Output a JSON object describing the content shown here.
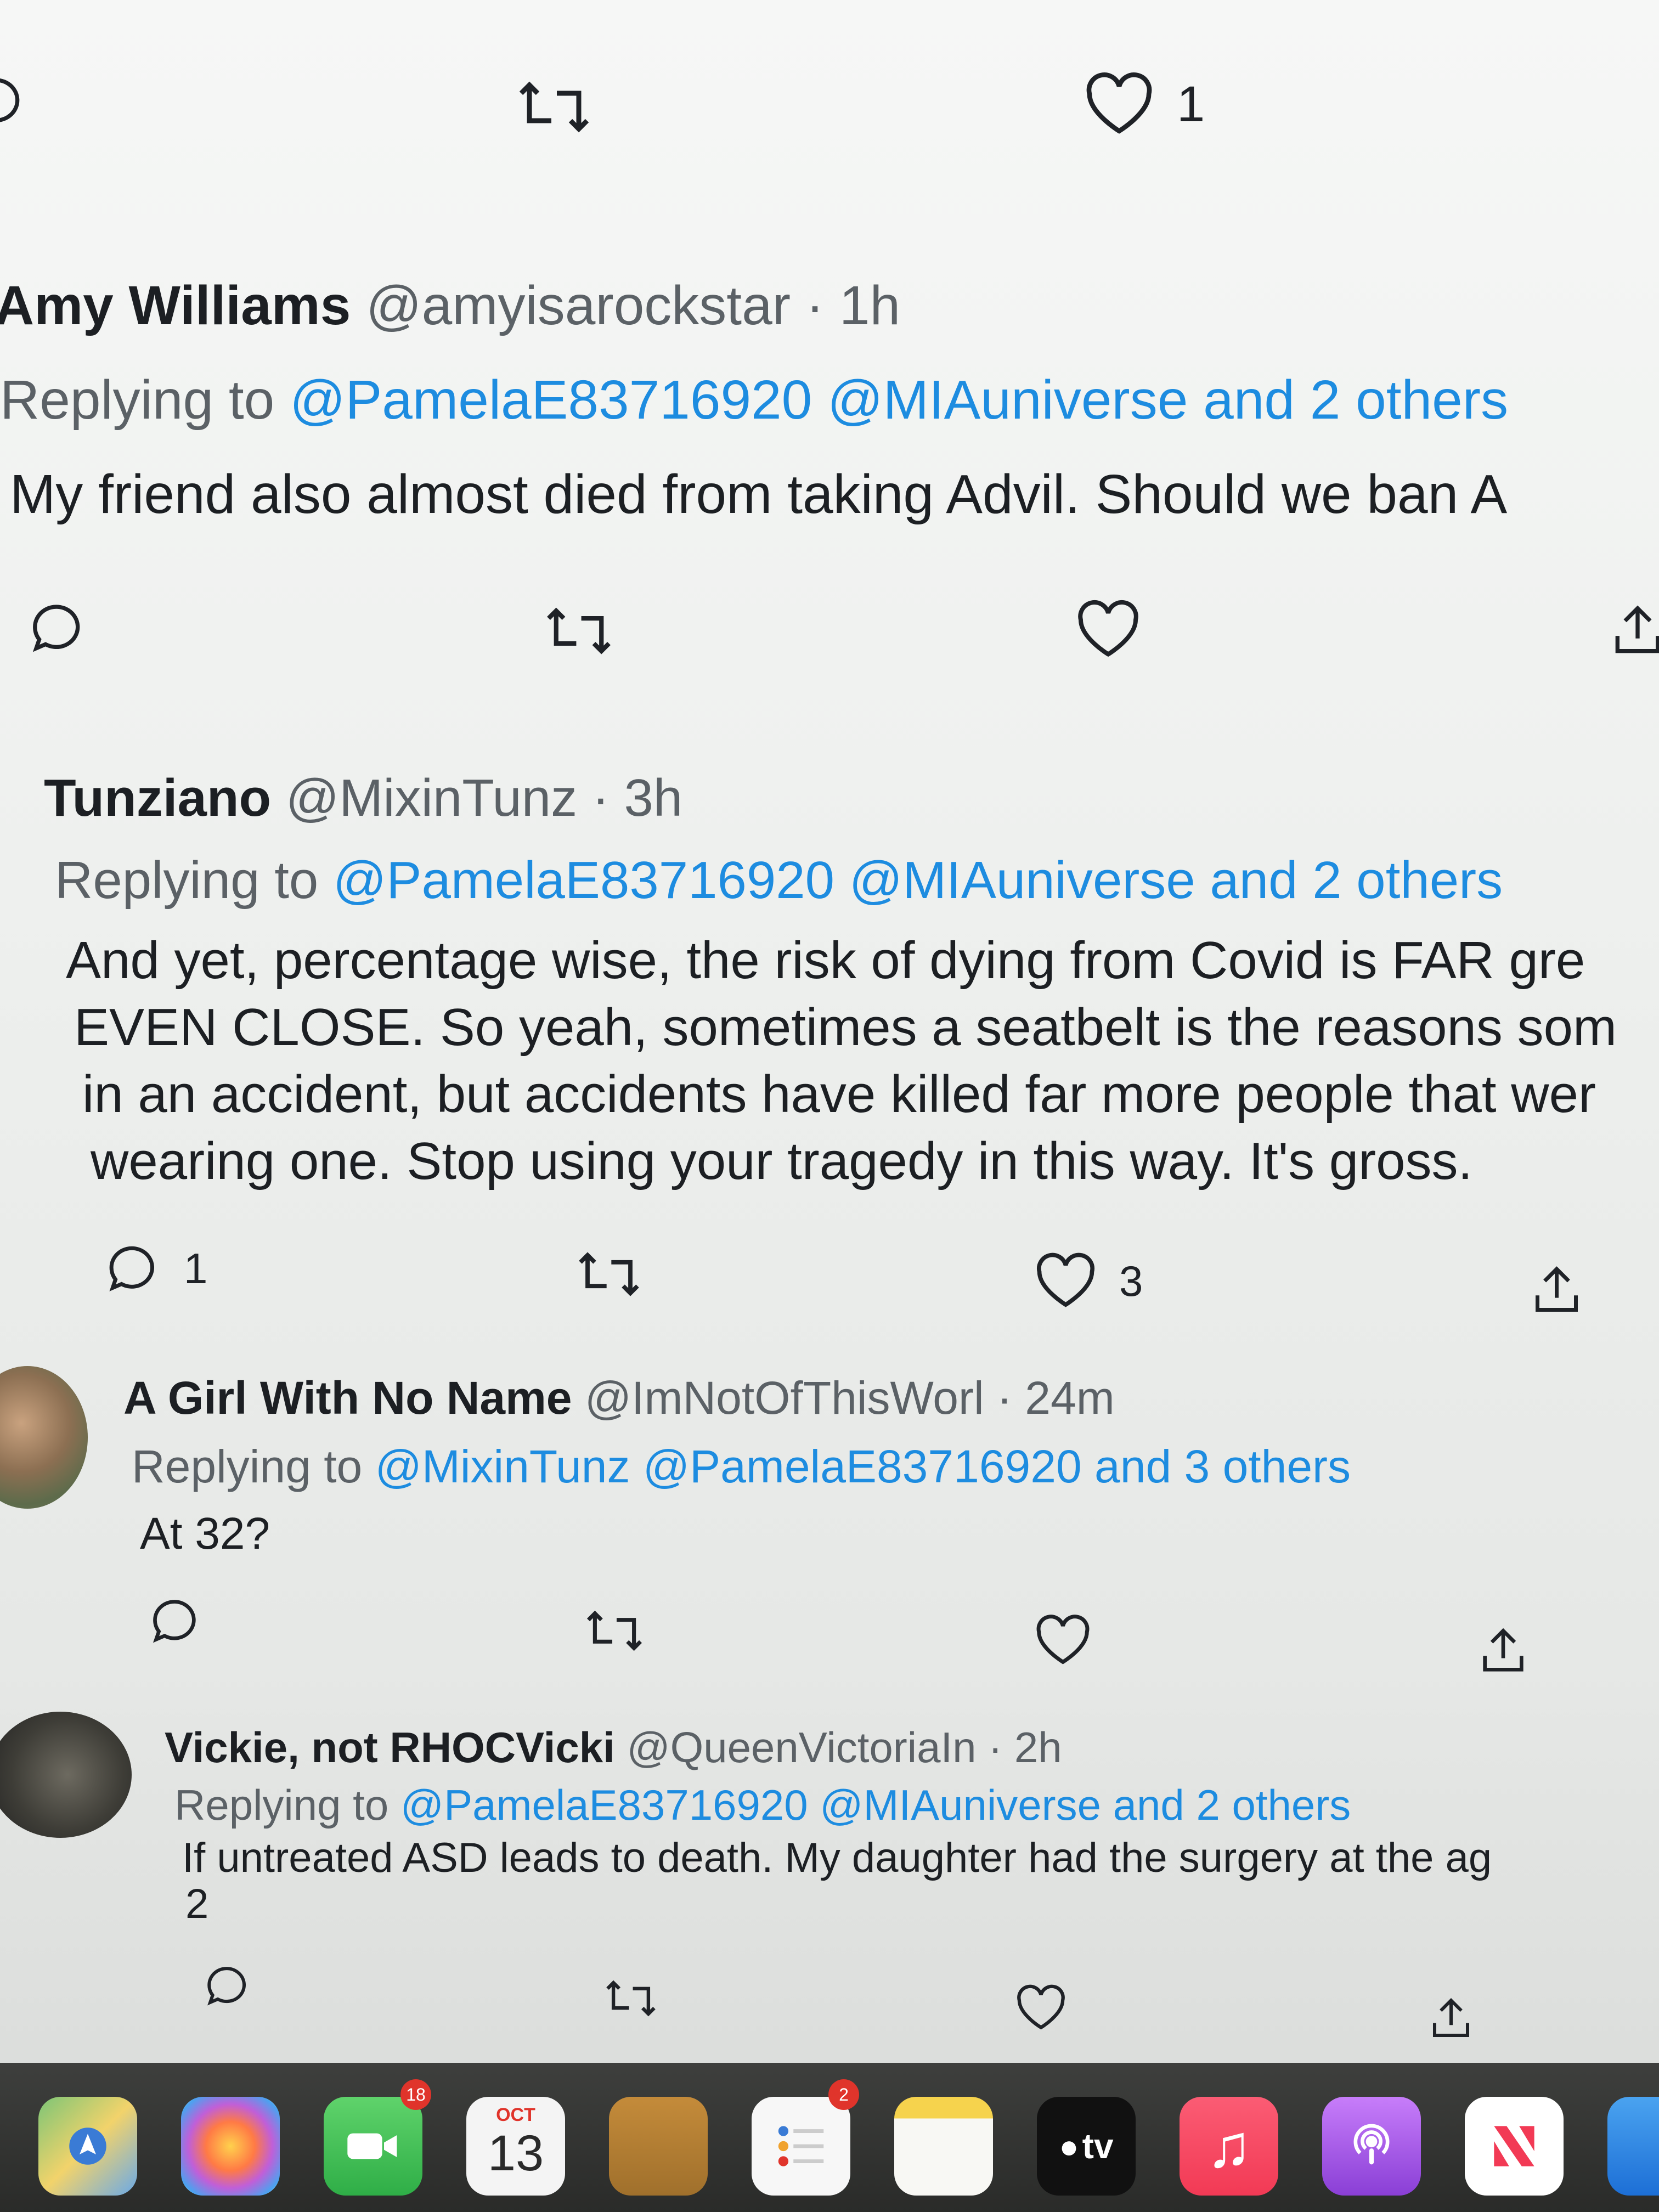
{
  "top_actions": {
    "like_count": "1"
  },
  "tweets": [
    {
      "name": "Amy Williams",
      "handle": "@amyisarockstar",
      "time": "· 1h",
      "replying_prefix": "Replying to",
      "replying_mentions": "@PamelaE83716920 @MIAuniverse and 2 others",
      "lines": [
        "My friend also almost died from taking Advil. Should we ban A"
      ],
      "reply_count": "",
      "like_count": ""
    },
    {
      "name": "Tunziano",
      "handle": "@MixinTunz",
      "time": "· 3h",
      "replying_prefix": "Replying to",
      "replying_mentions": "@PamelaE83716920 @MIAuniverse and 2 others",
      "lines": [
        "And yet, percentage wise, the risk of dying from Covid is FAR gre",
        "EVEN CLOSE. So yeah, sometimes a seatbelt is the reasons som",
        "in an accident, but accidents have killed far more people that wer",
        "wearing one. Stop using your tragedy in this way. It's gross."
      ],
      "reply_count": "1",
      "like_count": "3"
    },
    {
      "name": "A Girl With No Name",
      "handle": "@ImNotOfThisWorl",
      "time": "· 24m",
      "replying_prefix": "Replying to",
      "replying_mentions": "@MixinTunz @PamelaE83716920 and 3 others",
      "lines": [
        "At 32?"
      ],
      "reply_count": "",
      "like_count": ""
    },
    {
      "name": "Vickie, not RHOCVicki",
      "handle": "@QueenVictoriaIn",
      "time": "· 2h",
      "replying_prefix": "Replying to",
      "replying_mentions": "@PamelaE83716920 @MIAuniverse and 2 others",
      "lines": [
        "If untreated ASD leads to death. My daughter had the surgery at the ag",
        "2"
      ],
      "reply_count": "",
      "like_count": ""
    }
  ],
  "dock": {
    "calendar_month": "OCT",
    "calendar_day": "13",
    "facetime_badge": "18",
    "reminders_badge": "2",
    "tv_label": "tv"
  },
  "colors": {
    "mention_blue": "#1d8ce0",
    "text_dark": "#1c1f23",
    "text_gray": "#5b6166"
  },
  "icons": [
    "reply-icon",
    "retweet-icon",
    "like-icon",
    "share-icon"
  ]
}
